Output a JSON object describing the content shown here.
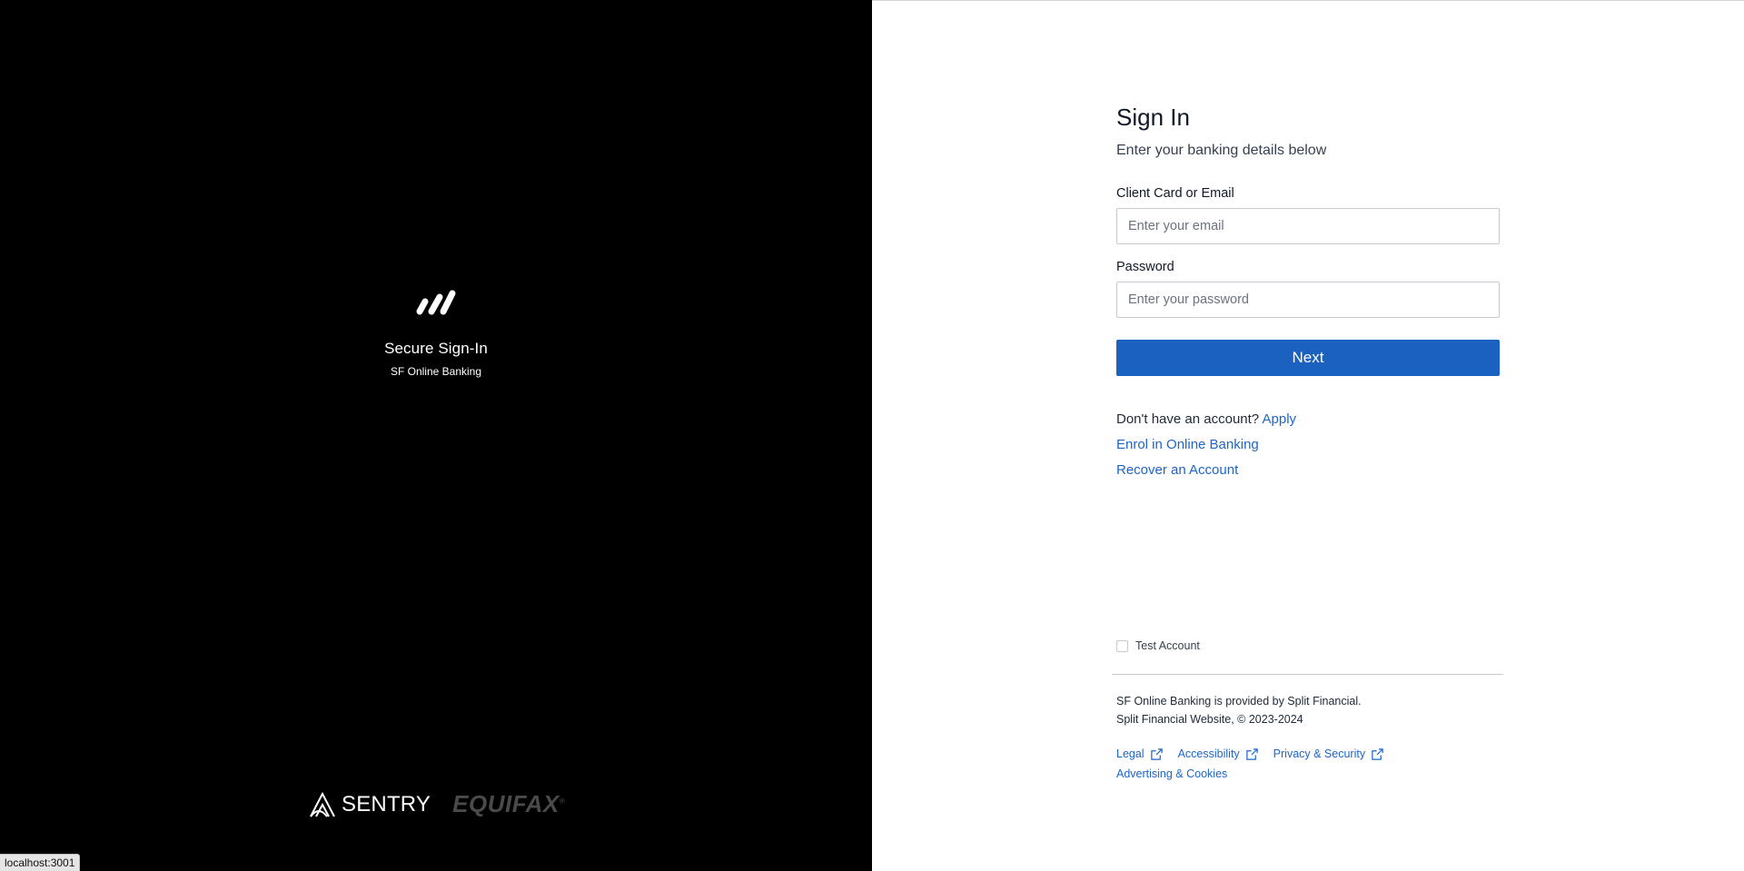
{
  "brand": {
    "logo_icon": "split-financial-logo-icon",
    "title": "Secure Sign-In",
    "subtitle": "SF Online Banking"
  },
  "partners": {
    "sentry": "SENTRY",
    "equifax": "EQUIFAX",
    "equifax_mark": "®"
  },
  "status_bar": {
    "url": "localhost:3001"
  },
  "signin": {
    "title": "Sign In",
    "subtitle": "Enter your banking details below",
    "email_label": "Client Card or Email",
    "email_placeholder": "Enter your email",
    "email_value": "",
    "password_label": "Password",
    "password_placeholder": "Enter your password",
    "password_value": "",
    "next_label": "Next"
  },
  "links": {
    "no_account_text": "Don't have an account?",
    "apply": "Apply",
    "enrol": "Enrol in Online Banking",
    "recover": "Recover an Account"
  },
  "test_account": {
    "label": "Test Account",
    "checked": false
  },
  "footer": {
    "line1": "SF Online Banking is provided by Split Financial.",
    "line2": "Split Financial Website, © 2023-2024",
    "links": {
      "legal": "Legal",
      "accessibility": "Accessibility",
      "privacy": "Privacy & Security",
      "advertising": "Advertising & Cookies"
    },
    "external_icon": "external-link-icon"
  },
  "colors": {
    "accent": "#1b61bf",
    "link": "#1e65c9",
    "left_panel_bg": "#000000"
  }
}
